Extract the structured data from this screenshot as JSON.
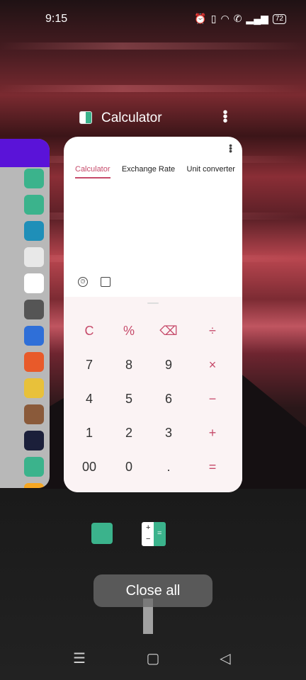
{
  "status_bar": {
    "time": "9:15",
    "battery": "72",
    "icons": [
      "alarm-icon",
      "vibrate-icon",
      "wifi-icon",
      "call-icon",
      "signal-icon",
      "battery-icon"
    ]
  },
  "recents": {
    "app_title": "Calculator",
    "close_all_label": "Close all"
  },
  "calculator": {
    "tabs": [
      "Calculator",
      "Exchange Rate",
      "Unit converter"
    ],
    "active_tab": "Calculator",
    "keys": [
      [
        "C",
        "%",
        "⌫",
        "÷"
      ],
      [
        "7",
        "8",
        "9",
        "×"
      ],
      [
        "4",
        "5",
        "6",
        "−"
      ],
      [
        "1",
        "2",
        "3",
        "+"
      ],
      [
        "00",
        "0",
        ".",
        "="
      ]
    ]
  },
  "dock": {
    "dock_b_plus": "+",
    "dock_b_minus": "−",
    "dock_b_equals": "="
  },
  "colors": {
    "accent": "#c64a6a",
    "green": "#3bb38c",
    "purple": "#5a13d8"
  }
}
